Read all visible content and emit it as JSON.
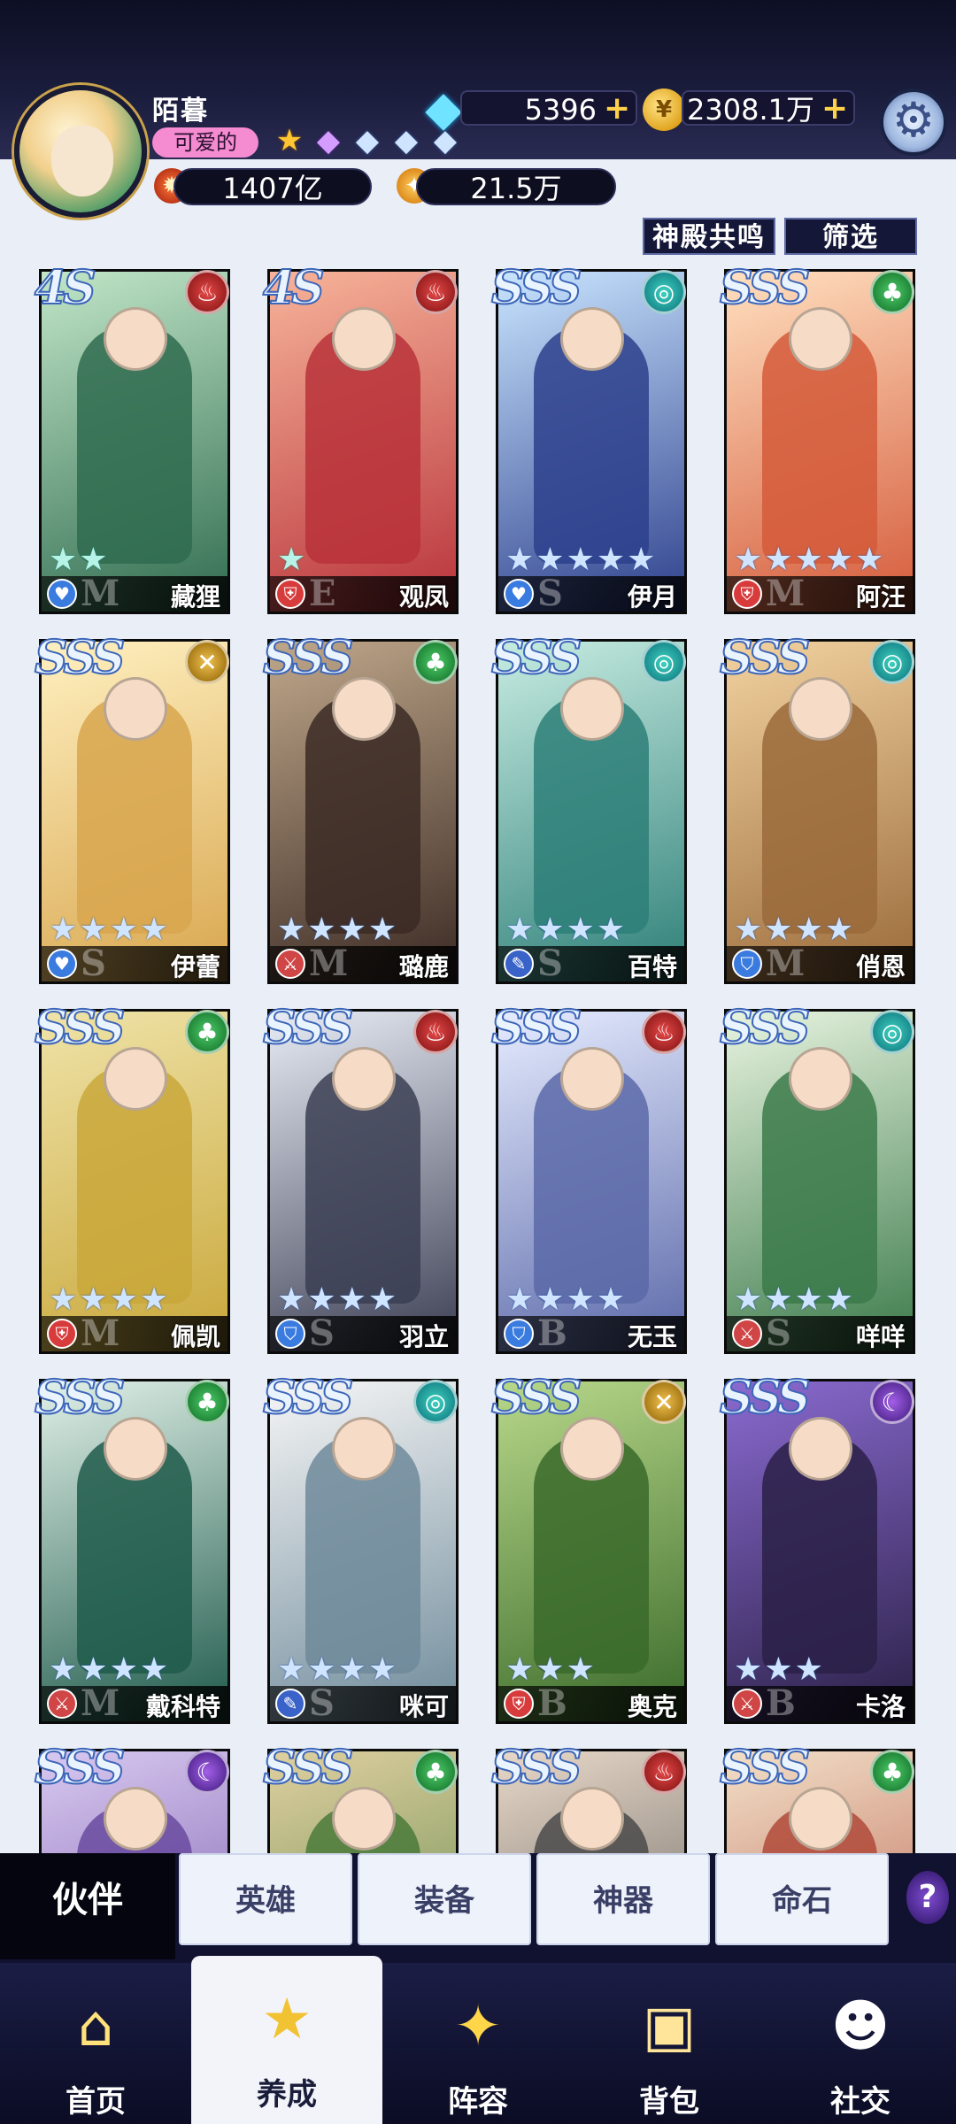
{
  "player": {
    "name": "陌暮",
    "title_badge": "可爱的",
    "power": "1407亿",
    "secondary_power": "21.5万"
  },
  "resources": {
    "diamonds": "5396",
    "gold": "2308.1万"
  },
  "filters": {
    "resonance_label": "神殿共鸣",
    "filter_label": "筛选"
  },
  "heroes": [
    {
      "rank": "4S",
      "name": "藏狸",
      "element": "fire",
      "class": "support",
      "grade": "M",
      "stars": 2,
      "star_color": "green"
    },
    {
      "rank": "4S",
      "name": "观凤",
      "element": "fire",
      "class": "tank",
      "grade": "E",
      "stars": 1,
      "star_color": "green"
    },
    {
      "rank": "SSS",
      "name": "伊月",
      "element": "wind",
      "class": "support",
      "grade": "S",
      "stars": 5,
      "star_color": "blue"
    },
    {
      "rank": "SSS",
      "name": "阿汪",
      "element": "nature",
      "class": "tank",
      "grade": "M",
      "stars": 5,
      "star_color": "blue"
    },
    {
      "rank": "SSS",
      "name": "伊蕾",
      "element": "light",
      "class": "support",
      "grade": "S",
      "stars": 4,
      "star_color": "blue"
    },
    {
      "rank": "SSS",
      "name": "璐鹿",
      "element": "nature",
      "class": "attack",
      "grade": "M",
      "stars": 4,
      "star_color": "blue"
    },
    {
      "rank": "SSS",
      "name": "百特",
      "element": "wind",
      "class": "magic",
      "grade": "S",
      "stars": 4,
      "star_color": "blue"
    },
    {
      "rank": "SSS",
      "name": "俏恩",
      "element": "wind",
      "class": "shield",
      "grade": "M",
      "stars": 4,
      "star_color": "blue"
    },
    {
      "rank": "SSS",
      "name": "佩凯",
      "element": "nature",
      "class": "tank",
      "grade": "M",
      "stars": 4,
      "star_color": "blue"
    },
    {
      "rank": "SSS",
      "name": "羽立",
      "element": "fire",
      "class": "shield",
      "grade": "S",
      "stars": 4,
      "star_color": "blue"
    },
    {
      "rank": "SSS",
      "name": "无玉",
      "element": "fire",
      "class": "shield",
      "grade": "B",
      "stars": 4,
      "star_color": "blue"
    },
    {
      "rank": "SSS",
      "name": "咩咩",
      "element": "wind",
      "class": "attack",
      "grade": "S",
      "stars": 4,
      "star_color": "blue"
    },
    {
      "rank": "SSS",
      "name": "戴科特",
      "element": "nature",
      "class": "attack",
      "grade": "M",
      "stars": 4,
      "star_color": "blue"
    },
    {
      "rank": "SSS",
      "name": "咪可",
      "element": "wind",
      "class": "magic",
      "grade": "S",
      "stars": 4,
      "star_color": "blue"
    },
    {
      "rank": "SSS",
      "name": "奥克",
      "element": "light",
      "class": "tank",
      "grade": "B",
      "stars": 3,
      "star_color": "blue"
    },
    {
      "rank": "SSS",
      "name": "卡洛",
      "element": "dark",
      "class": "attack",
      "grade": "B",
      "stars": 3,
      "star_color": "blue"
    },
    {
      "rank": "SSS",
      "name": "",
      "element": "dark",
      "class": "",
      "grade": "",
      "stars": 0,
      "star_color": "blue"
    },
    {
      "rank": "SSS",
      "name": "",
      "element": "nature",
      "class": "",
      "grade": "",
      "stars": 0,
      "star_color": "blue"
    },
    {
      "rank": "SSS",
      "name": "",
      "element": "fire",
      "class": "",
      "grade": "",
      "stars": 0,
      "star_color": "blue"
    },
    {
      "rank": "SSS",
      "name": "",
      "element": "nature",
      "class": "",
      "grade": "",
      "stars": 0,
      "star_color": "blue"
    }
  ],
  "tabs": {
    "active": "伙伴",
    "items": [
      "英雄",
      "装备",
      "神器",
      "命石"
    ],
    "help": "?"
  },
  "nav": {
    "items": [
      "首页",
      "养成",
      "阵容",
      "背包",
      "社交"
    ],
    "active_index": 1
  },
  "colors": {
    "header_bg": "#1b1d3d",
    "accent_gold": "#ffd14a",
    "title_pink": "#f58bd0"
  }
}
